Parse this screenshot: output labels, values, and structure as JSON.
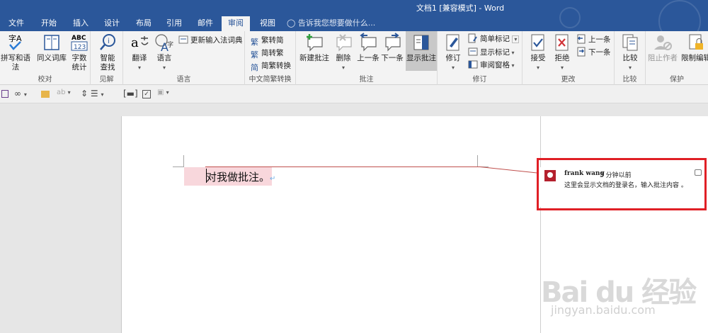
{
  "window": {
    "title": "文档1 [兼容模式] - Word"
  },
  "tabs": [
    "文件",
    "开始",
    "插入",
    "设计",
    "布局",
    "引用",
    "邮件",
    "审阅",
    "视图"
  ],
  "tell_me": "告诉我您想要做什么...",
  "ribbon": {
    "proofing": {
      "label": "校对",
      "spell": "拼写和语法",
      "thesaurus": "同义词库",
      "wordcount_l1": "字数",
      "wordcount_l2": "统计"
    },
    "insights": {
      "label": "见解",
      "smart_l1": "智能",
      "smart_l2": "查找"
    },
    "language": {
      "label": "语言",
      "translate": "翻译",
      "language": "语言",
      "update_ime": "更新输入法词典"
    },
    "chinese": {
      "label": "中文简繁转换",
      "to_trad": "繁转简",
      "to_simp": "简转繁",
      "convert": "简繁转换"
    },
    "comments": {
      "label": "批注",
      "new": "新建批注",
      "delete": "删除",
      "prev": "上一条",
      "next": "下一条",
      "show": "显示批注"
    },
    "tracking": {
      "label": "修订",
      "track": "修订",
      "simple_markup": "简单标记",
      "show_markup": "显示标记",
      "review_pane": "审阅窗格"
    },
    "changes": {
      "label": "更改",
      "accept": "接受",
      "reject": "拒绝",
      "prev": "上一条",
      "next": "下一条"
    },
    "compare": {
      "label": "比较",
      "compare": "比较"
    },
    "protect": {
      "label": "保护",
      "block": "阻止作者",
      "restrict": "限制编辑"
    }
  },
  "document": {
    "text": "对我做批注。"
  },
  "comment": {
    "author": "frank wang",
    "time": "3 分钟以前",
    "body": "这里会显示文档的登录名，输入批注内容 。"
  },
  "watermark": {
    "brand": "Bai du 经验",
    "url": "jingyan.baidu.com"
  },
  "colors": {
    "accent": "#2b579a",
    "highlight": "#f8d7dc",
    "red_frame": "#e01f26",
    "avatar": "#b4202d"
  }
}
